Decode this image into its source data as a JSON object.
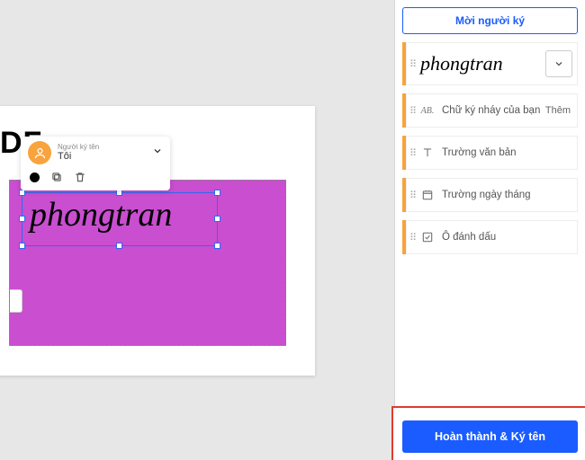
{
  "canvas": {
    "doc_text_fragment": "DF",
    "signature_value": "phongtran"
  },
  "signer_popover": {
    "role_label": "Người ký tên",
    "name": "Tôi"
  },
  "sidebar": {
    "invite_label": "Mời người ký",
    "signature_preview": "phongtran",
    "initials": {
      "label": "Chữ ký nháy của bạn",
      "action": "Thêm"
    },
    "text_field": {
      "label": "Trường văn bản"
    },
    "date_field": {
      "label": "Trường ngày tháng"
    },
    "checkbox_field": {
      "label": "Ô đánh dấu"
    }
  },
  "footer": {
    "complete_label": "Hoàn thành & Ký tên"
  }
}
